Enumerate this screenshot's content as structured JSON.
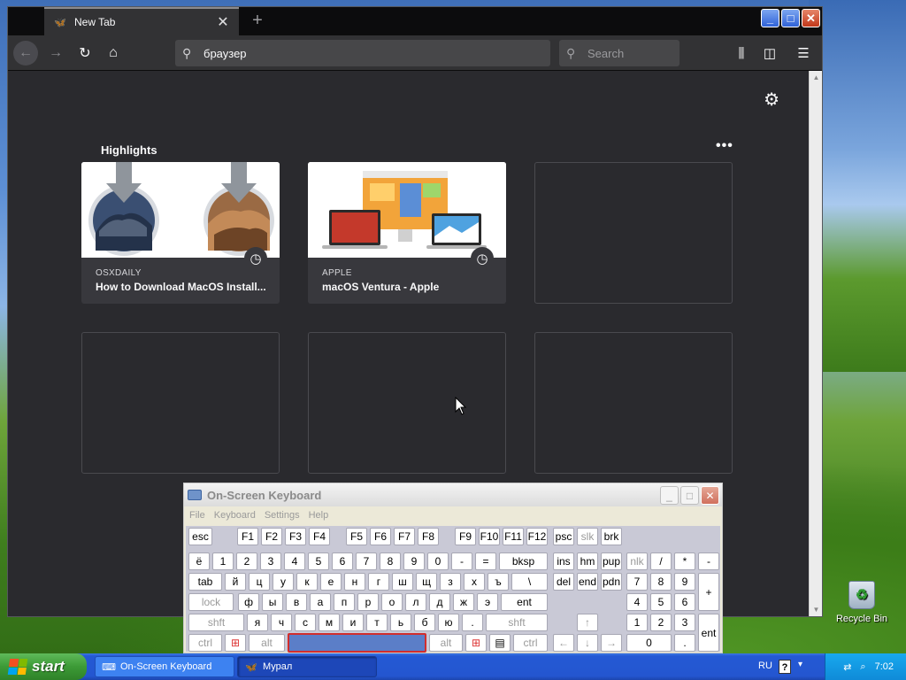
{
  "browser": {
    "tab": {
      "title": "New Tab",
      "favicon": "butterfly-icon",
      "close": "✕"
    },
    "new_tab": "+",
    "toolbar": {
      "back": "←",
      "forward": "→",
      "reload": "↻",
      "home": "⌂",
      "url_value": "браузер",
      "search_placeholder": "Search",
      "library": "⫼",
      "sidebar": "◫",
      "menu": "☰"
    },
    "window_buttons": {
      "minimize": "_",
      "maximize": "□",
      "close": "✕"
    },
    "content": {
      "settings_icon": "⚙",
      "highlights_title": "Highlights",
      "more": "•••",
      "cards": [
        {
          "host": "OSXDAILY",
          "title": "How to Download MacOS Install...",
          "icon": "clock-icon"
        },
        {
          "host": "APPLE",
          "title": "macOS Ventura - Apple",
          "icon": "clock-icon"
        }
      ]
    }
  },
  "osk": {
    "title": "On-Screen Keyboard",
    "menu": [
      "File",
      "Keyboard",
      "Settings",
      "Help"
    ],
    "rows": {
      "r1": [
        "esc",
        "F1",
        "F2",
        "F3",
        "F4",
        "F5",
        "F6",
        "F7",
        "F8",
        "F9",
        "F10",
        "F11",
        "F12",
        "psc",
        "slk",
        "brk"
      ],
      "r2": [
        "ё",
        "1",
        "2",
        "3",
        "4",
        "5",
        "6",
        "7",
        "8",
        "9",
        "0",
        "-",
        "=",
        "bksp",
        "ins",
        "hm",
        "pup",
        "nlk",
        "/",
        "*",
        "-"
      ],
      "r3": [
        "tab",
        "й",
        "ц",
        "у",
        "к",
        "е",
        "н",
        "г",
        "ш",
        "щ",
        "з",
        "х",
        "ъ",
        "\\",
        "del",
        "end",
        "pdn",
        "7",
        "8",
        "9",
        "+"
      ],
      "r4": [
        "lock",
        "ф",
        "ы",
        "в",
        "а",
        "п",
        "р",
        "о",
        "л",
        "д",
        "ж",
        "э",
        "ent",
        "4",
        "5",
        "6"
      ],
      "r5": [
        "shft",
        "я",
        "ч",
        "с",
        "м",
        "и",
        "т",
        "ь",
        "б",
        "ю",
        ".",
        "shft",
        "↑",
        "1",
        "2",
        "3",
        "ent"
      ],
      "r6": [
        "ctrl",
        "⊞",
        "alt",
        "",
        "alt",
        "⊞",
        "▤",
        "ctrl",
        "←",
        "↓",
        "→",
        "0",
        "."
      ]
    }
  },
  "desktop": {
    "recycle_bin": "Recycle Bin"
  },
  "taskbar": {
    "start": "start",
    "tasks": [
      "On-Screen Keyboard",
      "Мурал"
    ],
    "lang": "RU",
    "help": "?",
    "time": "7:02"
  }
}
